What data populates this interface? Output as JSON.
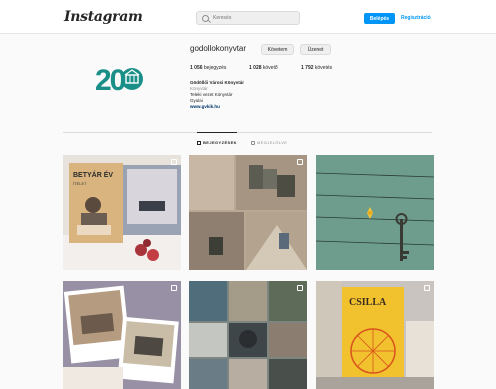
{
  "header": {
    "logo": "Instagram",
    "search_placeholder": "Keresés",
    "login_label": "Belépés",
    "signup_label": "Regisztráció"
  },
  "profile": {
    "avatar_number": "20",
    "username": "godollokonyvtar",
    "follow_label": "Követem",
    "message_label": "Üzenet",
    "stats": {
      "posts": "1 056",
      "posts_label": "bejegyzés",
      "followers": "1 028",
      "followers_label": "követő",
      "following": "1 792",
      "following_label": "követés"
    },
    "bio": {
      "name": "Gödöllői Városi Könyvtár",
      "category": "Könyvtár",
      "line1": "Teleki vezet Könyvtár",
      "line2": "Gyulai",
      "link": "www.gvkik.hu"
    }
  },
  "tabs": {
    "posts": "BEJEGYZÉSEK",
    "tagged": "MEGJELÖLVE"
  },
  "posts": {
    "book_cover_title": "BETYÁR ÉV",
    "book_cover_subtitle": "ÍTÉLET",
    "poster_title": "CSILLA"
  },
  "colors": {
    "accent": "#0095f6",
    "avatar_teal": "#1a8f87",
    "page_bg": "#fafafa"
  }
}
